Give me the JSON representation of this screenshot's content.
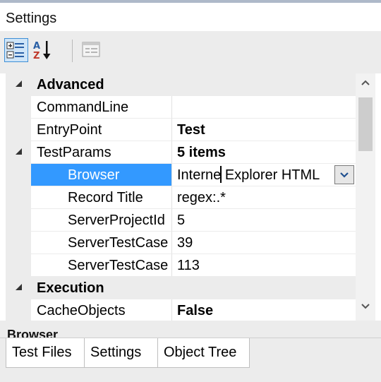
{
  "window": {
    "title": "Settings"
  },
  "toolbar": {
    "categorized_icon": "categorized-view-icon",
    "alphabetical_icon": "sort-alphabetical-icon",
    "property_pages_icon": "property-pages-icon"
  },
  "grid": {
    "rows": [
      {
        "kind": "category",
        "name": "Advanced",
        "expanded": true
      },
      {
        "kind": "property",
        "name": "CommandLine",
        "value": ""
      },
      {
        "kind": "property",
        "name": "EntryPoint",
        "value": "Test",
        "bold_value": true
      },
      {
        "kind": "property",
        "name": "TestParams",
        "value": "5 items",
        "expandable": true,
        "bold_value": true
      },
      {
        "kind": "property",
        "name": "Browser",
        "value": "Interne Explorer HTML",
        "selected": true,
        "editing": true
      },
      {
        "kind": "property",
        "name": "Record Title",
        "value": "regex:.*"
      },
      {
        "kind": "property",
        "name": "ServerProjectId",
        "value": "5"
      },
      {
        "kind": "property",
        "name": "ServerTestCase",
        "value": "39"
      },
      {
        "kind": "property",
        "name": "ServerTestCase",
        "value": "113"
      },
      {
        "kind": "category",
        "name": "Execution",
        "expanded": true
      },
      {
        "kind": "property",
        "name": "CacheObjects",
        "value": "False",
        "bold_value": true
      }
    ]
  },
  "description": {
    "title": "Browser"
  },
  "tabs": [
    {
      "label": "Test Files",
      "active": false
    },
    {
      "label": "Settings",
      "active": true
    },
    {
      "label": "Object Tree",
      "active": false
    }
  ],
  "colors": {
    "selection": "#3399ff",
    "margin": "#ececec",
    "toolbar_active": "#cfe5f8"
  }
}
